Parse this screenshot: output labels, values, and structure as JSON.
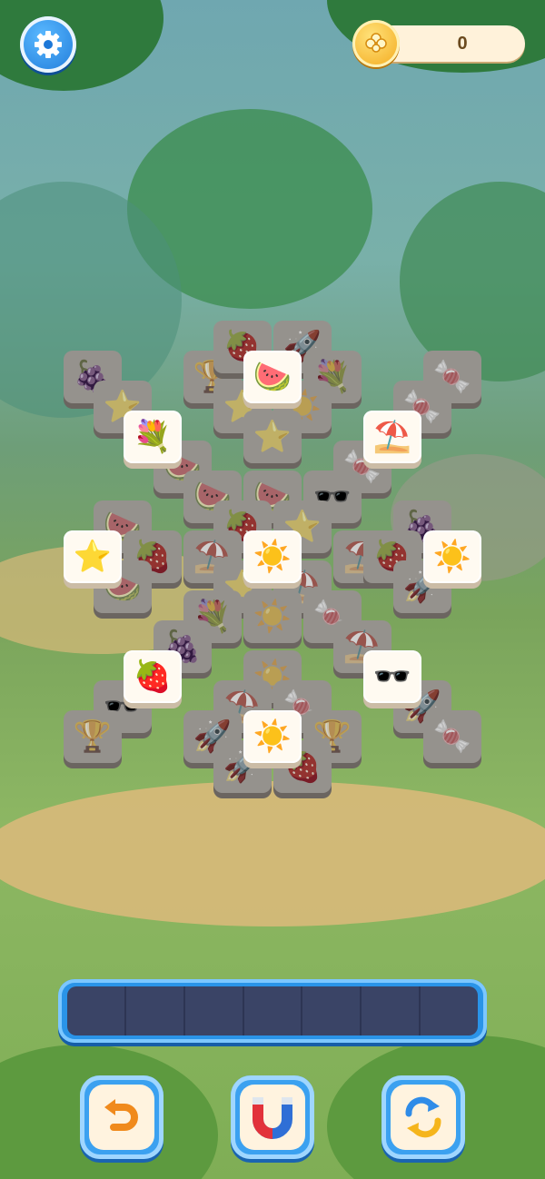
{
  "hud": {
    "settings_icon": "gear-icon",
    "coin_icon": "coin-icon",
    "coin_count": "0"
  },
  "board": {
    "tiles": [
      {
        "id": "t1",
        "item": "grapes",
        "glyph": "🍇",
        "state": "blocked"
      },
      {
        "id": "t2",
        "item": "star",
        "glyph": "⭐",
        "state": "blocked"
      },
      {
        "id": "t3",
        "item": "trophy",
        "glyph": "🏆",
        "state": "blocked"
      },
      {
        "id": "t4",
        "item": "strawberry",
        "glyph": "🍓",
        "state": "blocked"
      },
      {
        "id": "t5",
        "item": "rocket",
        "glyph": "🚀",
        "state": "blocked"
      },
      {
        "id": "t6",
        "item": "flowers",
        "glyph": "💐",
        "state": "blocked"
      },
      {
        "id": "t7",
        "item": "candy",
        "glyph": "🍬",
        "state": "blocked"
      },
      {
        "id": "t8",
        "item": "candy",
        "glyph": "🍬",
        "state": "blocked"
      },
      {
        "id": "t9",
        "item": "star",
        "glyph": "⭐",
        "state": "blocked"
      },
      {
        "id": "t10",
        "item": "sun",
        "glyph": "☀️",
        "state": "blocked"
      },
      {
        "id": "t11",
        "item": "star",
        "glyph": "⭐",
        "state": "blocked"
      },
      {
        "id": "t12",
        "item": "watermelon",
        "glyph": "🍉",
        "state": "blocked"
      },
      {
        "id": "t13",
        "item": "candy",
        "glyph": "🍬",
        "state": "blocked"
      },
      {
        "id": "t14",
        "item": "watermelon",
        "glyph": "🍉",
        "state": "blocked"
      },
      {
        "id": "t15",
        "item": "watermelon",
        "glyph": "🍉",
        "state": "blocked"
      },
      {
        "id": "t16",
        "item": "sunglasses",
        "glyph": "🕶️",
        "state": "blocked"
      },
      {
        "id": "t17",
        "item": "watermelon",
        "glyph": "🍉",
        "state": "blocked"
      },
      {
        "id": "t18",
        "item": "strawberry",
        "glyph": "🍓",
        "state": "blocked"
      },
      {
        "id": "t19",
        "item": "star",
        "glyph": "⭐",
        "state": "blocked"
      },
      {
        "id": "t20",
        "item": "grapes",
        "glyph": "🍇",
        "state": "blocked"
      },
      {
        "id": "t21",
        "item": "strawberry",
        "glyph": "🍓",
        "state": "blocked"
      },
      {
        "id": "t22",
        "item": "umbrella",
        "glyph": "⛱️",
        "state": "blocked"
      },
      {
        "id": "t23",
        "item": "umbrella",
        "glyph": "⛱️",
        "state": "blocked"
      },
      {
        "id": "t24",
        "item": "strawberry",
        "glyph": "🍓",
        "state": "blocked"
      },
      {
        "id": "t25",
        "item": "watermelon",
        "glyph": "🍉",
        "state": "blocked"
      },
      {
        "id": "t26",
        "item": "star",
        "glyph": "⭐",
        "state": "blocked"
      },
      {
        "id": "t27",
        "item": "umbrella",
        "glyph": "⛱️",
        "state": "blocked"
      },
      {
        "id": "t28",
        "item": "rocket",
        "glyph": "🚀",
        "state": "blocked"
      },
      {
        "id": "t29",
        "item": "flowers",
        "glyph": "💐",
        "state": "blocked"
      },
      {
        "id": "t30",
        "item": "sun",
        "glyph": "☀️",
        "state": "blocked"
      },
      {
        "id": "t31",
        "item": "candy",
        "glyph": "🍬",
        "state": "blocked"
      },
      {
        "id": "t32",
        "item": "grapes",
        "glyph": "🍇",
        "state": "blocked"
      },
      {
        "id": "t33",
        "item": "umbrella",
        "glyph": "⛱️",
        "state": "blocked"
      },
      {
        "id": "t34",
        "item": "sun",
        "glyph": "☀️",
        "state": "blocked"
      },
      {
        "id": "t35",
        "item": "sunglasses",
        "glyph": "🕶️",
        "state": "blocked"
      },
      {
        "id": "t36",
        "item": "umbrella",
        "glyph": "⛱️",
        "state": "blocked"
      },
      {
        "id": "t37",
        "item": "candy",
        "glyph": "🍬",
        "state": "blocked"
      },
      {
        "id": "t38",
        "item": "rocket",
        "glyph": "🚀",
        "state": "blocked"
      },
      {
        "id": "t39",
        "item": "trophy",
        "glyph": "🏆",
        "state": "blocked"
      },
      {
        "id": "t40",
        "item": "rocket",
        "glyph": "🚀",
        "state": "blocked"
      },
      {
        "id": "t41",
        "item": "trophy",
        "glyph": "🏆",
        "state": "blocked"
      },
      {
        "id": "t42",
        "item": "candy",
        "glyph": "🍬",
        "state": "blocked"
      },
      {
        "id": "t43",
        "item": "rocket",
        "glyph": "🚀",
        "state": "blocked"
      },
      {
        "id": "t44",
        "item": "strawberry",
        "glyph": "🍓",
        "state": "blocked"
      },
      {
        "id": "t45",
        "item": "watermelon",
        "glyph": "🍉",
        "state": "free"
      },
      {
        "id": "t46",
        "item": "flowers",
        "glyph": "💐",
        "state": "free"
      },
      {
        "id": "t47",
        "item": "umbrella",
        "glyph": "⛱️",
        "state": "free"
      },
      {
        "id": "t48",
        "item": "star",
        "glyph": "⭐",
        "state": "free"
      },
      {
        "id": "t49",
        "item": "sun",
        "glyph": "☀️",
        "state": "free"
      },
      {
        "id": "t50",
        "item": "sun",
        "glyph": "☀️",
        "state": "free"
      },
      {
        "id": "t51",
        "item": "strawberry",
        "glyph": "🍓",
        "state": "free"
      },
      {
        "id": "t52",
        "item": "sunglasses",
        "glyph": "🕶️",
        "state": "free"
      },
      {
        "id": "t53",
        "item": "sun",
        "glyph": "☀️",
        "state": "free"
      }
    ]
  },
  "tray": {
    "slot_count": 7,
    "slots": [
      "",
      "",
      "",
      "",
      "",
      "",
      ""
    ]
  },
  "powerups": [
    {
      "name": "undo",
      "icon": "undo-arrow-icon"
    },
    {
      "name": "magnet",
      "icon": "magnet-icon"
    },
    {
      "name": "shuffle",
      "icon": "shuffle-icon"
    }
  ],
  "colors": {
    "accent": "#2a94e8",
    "tile_free": "#fffaf1",
    "tile_blocked": "#b9b2a7",
    "coin": "#f3a81a"
  }
}
